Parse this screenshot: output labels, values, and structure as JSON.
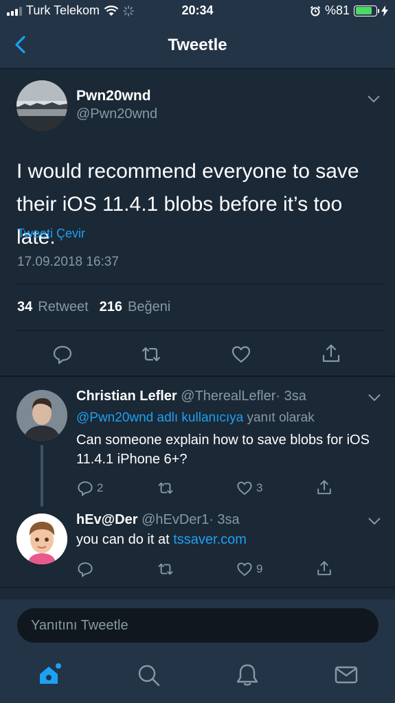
{
  "status_bar": {
    "carrier": "Turk Telekom",
    "time": "20:34",
    "battery_percent": "%81",
    "battery_level": 0.81
  },
  "nav": {
    "title": "Tweetle",
    "back_icon": "chevron-left-icon"
  },
  "tweet": {
    "author_name": "Pwn20wnd",
    "author_handle": "@Pwn20wnd",
    "text": "I would recommend everyone to save their iOS 11.4.1 blobs before it’s too late.",
    "translate_label": "Tweeti Çevir",
    "date": "17.09.2018 16:37",
    "retweet_count": "34",
    "retweet_label": "Retweet",
    "like_count": "216",
    "like_label": "Beğeni"
  },
  "replies": [
    {
      "name": "Christian Lefler",
      "handle": "@TherealLefler",
      "time": "· 3sa",
      "reply_mention": "@Pwn20wnd adlı kullanıcıya",
      "reply_suffix": "yanıt olarak",
      "text": "Can someone explain how to save blobs for iOS 11.4.1 iPhone 6+?",
      "reply_count": "2",
      "retweet_count": "",
      "like_count": "3"
    },
    {
      "name": "hEv@Der",
      "handle": "@hEvDer1",
      "time": "· 3sa",
      "text_prefix": "you can do it at",
      "text_link": "tssaver.com",
      "reply_count": "",
      "retweet_count": "",
      "like_count": "9"
    }
  ],
  "compose": {
    "placeholder": "Yanıtını Tweetle"
  },
  "tabs": [
    "home-icon",
    "search-icon",
    "notifications-bell-icon",
    "messages-envelope-icon"
  ],
  "colors": {
    "background": "#1b2836",
    "bar": "#243447",
    "accent": "#1da1f2",
    "muted": "#8899a6",
    "battery": "#4cd964"
  }
}
